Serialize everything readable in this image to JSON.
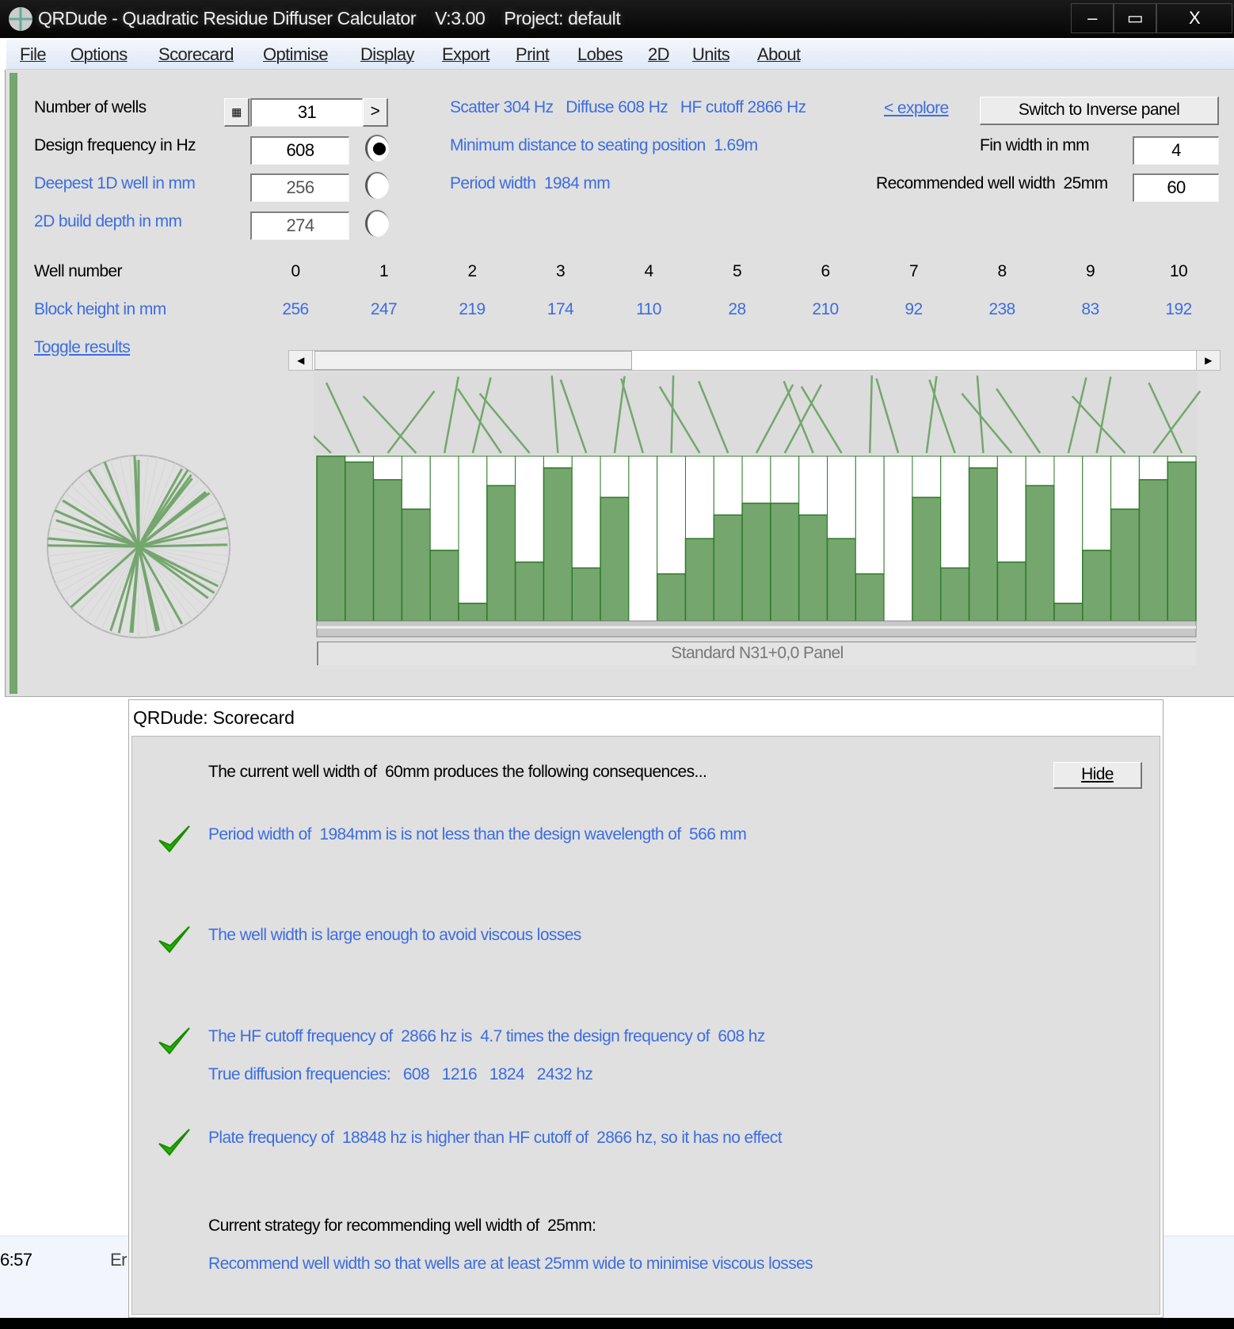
{
  "window": {
    "title": "QRDude - Quadratic Residue Diffuser Calculator",
    "version": "V:3.00",
    "project": "Project: default",
    "minimize": "‒",
    "maximize": "▭",
    "close": "X"
  },
  "menu": [
    "File",
    "Options",
    "Scorecard",
    "Optimise",
    "Display",
    "Export",
    "Print",
    "Lobes",
    "2D",
    "Units",
    "About"
  ],
  "params": {
    "wells_label": "Number of wells",
    "wells_value": "31",
    "wells_next": ">",
    "freq_label": "Design frequency in Hz",
    "freq_value": "608",
    "deepest_label": "Deepest 1D well in mm",
    "deepest_value": "256",
    "depth2d_label": "2D build depth in mm",
    "depth2d_value": "274",
    "selected_radio": "design-frequency"
  },
  "info": {
    "scatter": "Scatter 304 Hz",
    "diffuse": "Diffuse 608 Hz",
    "hf": "HF cutoff 2866 Hz",
    "min_dist": "Minimum distance to seating position  1.69m",
    "period": "Period width  1984 mm",
    "explore": "< explore",
    "switch": "Switch to Inverse panel",
    "fin_label": "Fin width in mm",
    "fin_value": "4",
    "rec_label": "Recommended well width  25mm",
    "rec_value": "60"
  },
  "table": {
    "well_label": "Well number",
    "block_label": "Block height in mm",
    "wells": [
      "0",
      "1",
      "2",
      "3",
      "4",
      "5",
      "6",
      "7",
      "8",
      "9",
      "10"
    ],
    "heights": [
      "256",
      "247",
      "219",
      "174",
      "110",
      "28",
      "210",
      "92",
      "238",
      "83",
      "192"
    ],
    "toggle": "Toggle results"
  },
  "scroll": {
    "position_fraction": 0.36
  },
  "panel_label": "Standard N31+0,0 Panel",
  "colors": {
    "well_green": "#74a66e",
    "link_blue": "#3c6de0",
    "check_green": "#22b000"
  },
  "scorecard": {
    "title": "QRDude: Scorecard",
    "intro": "The current well width of  60mm produces the following consequences...",
    "hide": "Hide",
    "checks": [
      "Period width of  1984mm is is not less than the design wavelength of  566 mm",
      "The well width is large enough to avoid viscous losses",
      "The HF cutoff frequency of  2866 hz is  4.7 times the design frequency of  608 hz",
      "Plate frequency of  18848 hz is higher than HF cutoff of  2866 hz, so it has no effect"
    ],
    "true_diffusion": "True diffusion frequencies:   608   1216   1824   2432 hz",
    "strategy_label": "Current strategy for recommending well width of  25mm:",
    "strategy": "Recommend well width so that wells are at least 25mm wide to minimise viscous losses"
  },
  "background": {
    "time": "6:57",
    "text": "Er"
  }
}
